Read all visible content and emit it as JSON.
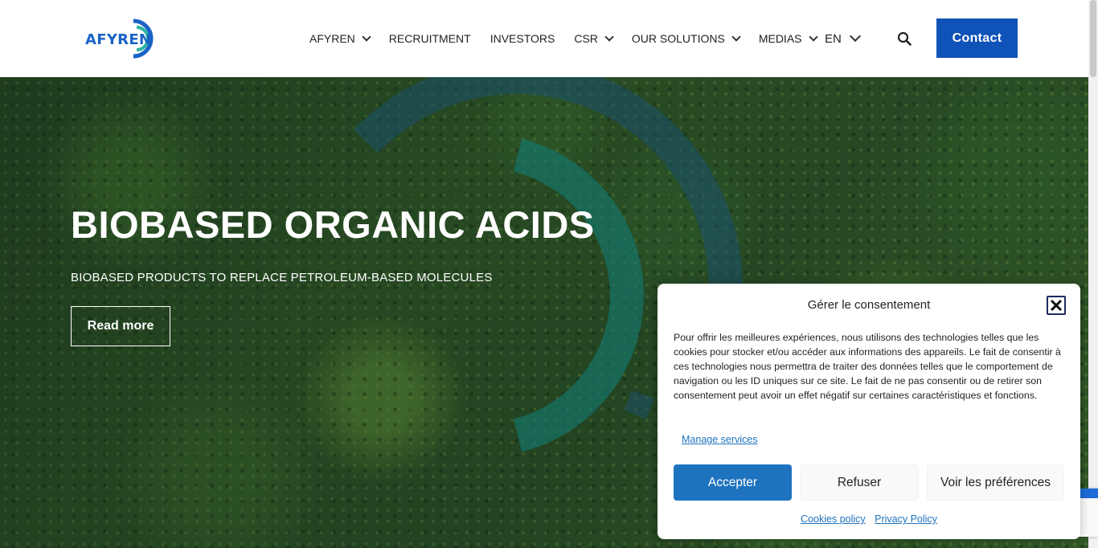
{
  "header": {
    "logo_text": "AFYREN",
    "nav": [
      {
        "label": "AFYREN",
        "has_dropdown": true
      },
      {
        "label": "RECRUITMENT",
        "has_dropdown": false
      },
      {
        "label": "INVESTORS",
        "has_dropdown": false
      },
      {
        "label": "CSR",
        "has_dropdown": true
      },
      {
        "label": "OUR SOLUTIONS",
        "has_dropdown": true
      },
      {
        "label": "MEDIAS",
        "has_dropdown": true
      }
    ],
    "language": "EN",
    "search_icon": "search-icon",
    "contact_label": "Contact"
  },
  "hero": {
    "title": "BIOBASED ORGANIC ACIDS",
    "subtitle": "BIOBASED PRODUCTS TO REPLACE PETROLEUM-BASED MOLECULES",
    "cta_label": "Read more"
  },
  "consent": {
    "title": "Gérer le consentement",
    "body": "Pour offrir les meilleures expériences, nous utilisons des technologies telles que les cookies pour stocker et/ou accéder aux informations des appareils. Le fait de consentir à ces technologies nous permettra de traiter des données telles que le comportement de navigation ou les ID uniques sur ce site. Le fait de ne pas consentir ou de retirer son consentement peut avoir un effet négatif sur certaines caractéristiques et fonctions.",
    "manage_link": "Manage services",
    "accept_label": "Accepter",
    "refuse_label": "Refuser",
    "preferences_label": "Voir les préférences",
    "cookies_policy_label": "Cookies policy",
    "privacy_policy_label": "Privacy Policy"
  },
  "colors": {
    "brand_blue": "#0f52b8",
    "accept_blue": "#1e73be",
    "logo_teal": "#2bb3a3",
    "forest_green": "#2f5526"
  }
}
